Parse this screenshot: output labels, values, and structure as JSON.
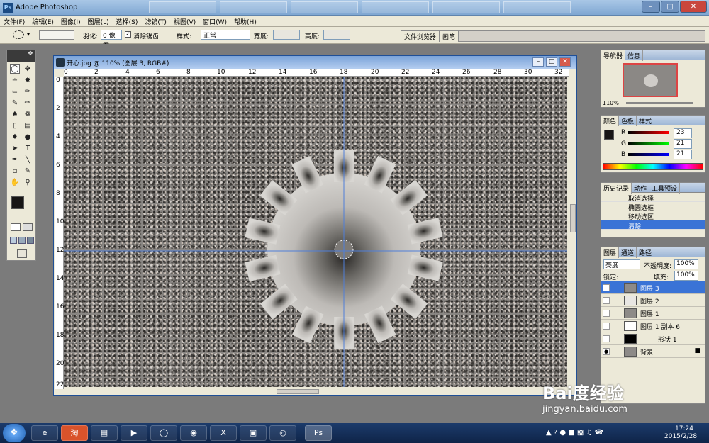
{
  "app": {
    "title": "Adobe Photoshop"
  },
  "menu": [
    "文件(F)",
    "编辑(E)",
    "图像(I)",
    "图层(L)",
    "选择(S)",
    "滤镜(T)",
    "视图(V)",
    "窗口(W)",
    "帮助(H)"
  ],
  "options": {
    "feather_label": "羽化:",
    "feather_value": "0 像素",
    "antialias_label": "消除锯齿",
    "style_label": "样式:",
    "style_value": "正常",
    "width_label": "宽度:",
    "height_label": "高度:"
  },
  "palette_well": [
    "文件浏览器",
    "画笔"
  ],
  "document": {
    "title": "开心.jpg @ 110% (图层 3, RGB#)",
    "ruler_top": [
      "0",
      "2",
      "4",
      "6",
      "8",
      "10",
      "12",
      "14",
      "16",
      "18",
      "20",
      "22",
      "24",
      "26",
      "28",
      "30",
      "32"
    ],
    "ruler_left": [
      "0",
      "2",
      "4",
      "6",
      "8",
      "10",
      "12",
      "14",
      "16",
      "18",
      "20",
      "22"
    ]
  },
  "navigator": {
    "tabs": [
      "导航器",
      "信息"
    ],
    "zoom": "110%"
  },
  "color": {
    "tabs": [
      "颜色",
      "色板",
      "样式"
    ],
    "r_label": "R",
    "g_label": "G",
    "b_label": "B",
    "r": "23",
    "g": "21",
    "b": "21"
  },
  "history": {
    "tabs": [
      "历史记录",
      "动作",
      "工具预设"
    ],
    "items": [
      "取消选择",
      "椭圆选框",
      "移动选区",
      "清除"
    ]
  },
  "layers": {
    "tabs": [
      "图层",
      "通道",
      "路径"
    ],
    "blend_mode": "亮度",
    "opacity_label": "不透明度:",
    "opacity_value": "100%",
    "lock_label": "锁定:",
    "fill_label": "填充:",
    "fill_value": "100%",
    "items": [
      "图层 3",
      "图层 2",
      "图层 1",
      "图层 1 副本 6",
      "形状 1",
      "背景"
    ]
  },
  "taskbar": {
    "time": "17:24",
    "date": "2015/2/28"
  },
  "watermark": {
    "logo": "Bai度经验",
    "url": "jingyan.baidu.com"
  },
  "colors": {
    "selection_blue": "#3a73d6",
    "guide_blue": "#4f7ed8"
  }
}
